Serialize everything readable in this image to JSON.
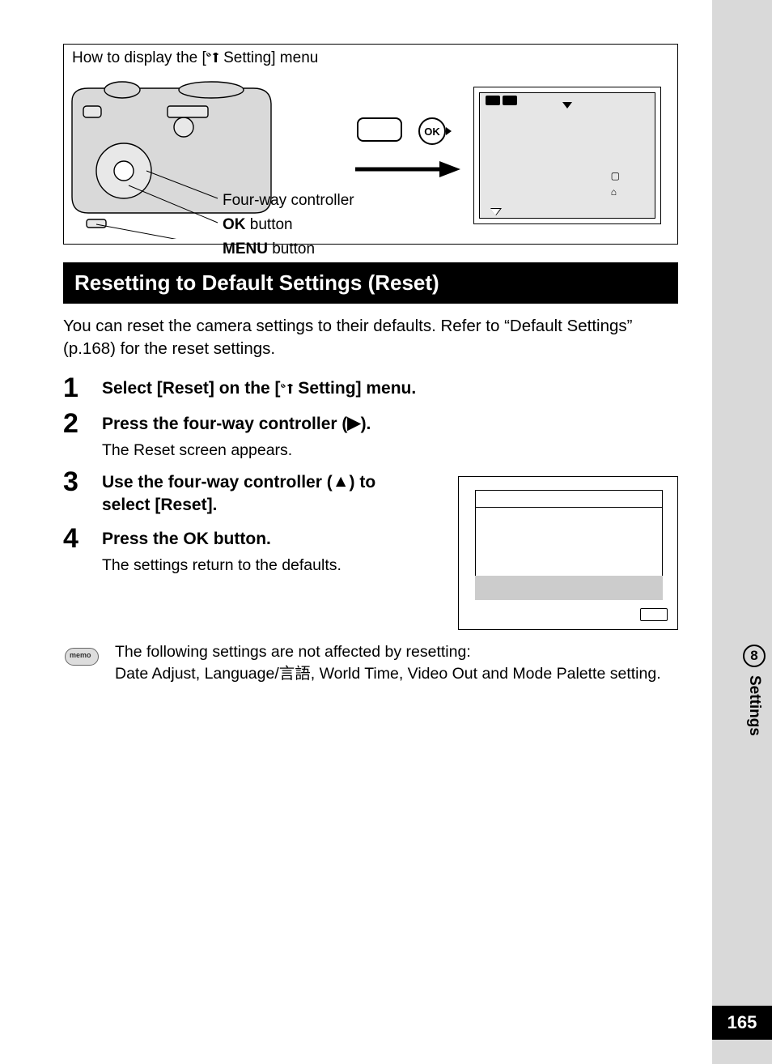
{
  "howto": {
    "title_prefix": "How to display the [",
    "title_suffix": " Setting] menu",
    "label_fourway": "Four-way controller",
    "label_ok_bold": "OK",
    "label_ok_rest": "  button",
    "label_menu_bold": "MENU",
    "label_menu_rest": " button",
    "ok_badge": "OK"
  },
  "section_header": "Resetting to Default Settings (Reset)",
  "intro": "You can reset the camera settings to their defaults. Refer to “Default Settings” (p.168) for the reset settings.",
  "steps": [
    {
      "num": "1",
      "title_pre": "Select [Reset] on the [",
      "title_post": " Setting] menu.",
      "sub": ""
    },
    {
      "num": "2",
      "title_pre": "Press the four-way controller (",
      "title_post": ").",
      "glyph": "▶",
      "sub": "The Reset screen appears."
    },
    {
      "num": "3",
      "title_pre": "Use the four-way controller (",
      "title_post": ") to select [Reset].",
      "glyph": "▲",
      "sub": ""
    },
    {
      "num": "4",
      "title_pre": "Press the ",
      "title_post": " button.",
      "bold_mid": "OK",
      "sub": "The settings return to the defaults."
    }
  ],
  "memo": {
    "label": "memo",
    "line1": "The following settings are not affected by resetting:",
    "line2_pre": "Date Adjust, Language/",
    "line2_cjk": "言語",
    "line2_post": ", World Time, Video Out and Mode Palette setting."
  },
  "sidebar": {
    "chapter_num": "8",
    "chapter_label": "Settings"
  },
  "page_number": "165"
}
